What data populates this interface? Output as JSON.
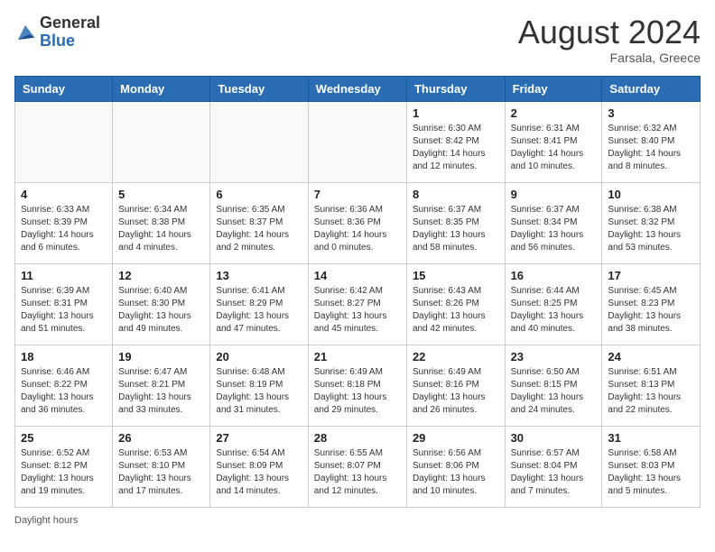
{
  "header": {
    "logo": {
      "general": "General",
      "blue": "Blue"
    },
    "title": "August 2024",
    "location": "Farsala, Greece"
  },
  "days_of_week": [
    "Sunday",
    "Monday",
    "Tuesday",
    "Wednesday",
    "Thursday",
    "Friday",
    "Saturday"
  ],
  "footer": {
    "daylight_hours": "Daylight hours"
  },
  "weeks": [
    [
      {
        "day": "",
        "sunrise": "",
        "sunset": "",
        "daylight": ""
      },
      {
        "day": "",
        "sunrise": "",
        "sunset": "",
        "daylight": ""
      },
      {
        "day": "",
        "sunrise": "",
        "sunset": "",
        "daylight": ""
      },
      {
        "day": "",
        "sunrise": "",
        "sunset": "",
        "daylight": ""
      },
      {
        "day": "1",
        "sunrise": "Sunrise: 6:30 AM",
        "sunset": "Sunset: 8:42 PM",
        "daylight": "Daylight: 14 hours and 12 minutes."
      },
      {
        "day": "2",
        "sunrise": "Sunrise: 6:31 AM",
        "sunset": "Sunset: 8:41 PM",
        "daylight": "Daylight: 14 hours and 10 minutes."
      },
      {
        "day": "3",
        "sunrise": "Sunrise: 6:32 AM",
        "sunset": "Sunset: 8:40 PM",
        "daylight": "Daylight: 14 hours and 8 minutes."
      }
    ],
    [
      {
        "day": "4",
        "sunrise": "Sunrise: 6:33 AM",
        "sunset": "Sunset: 8:39 PM",
        "daylight": "Daylight: 14 hours and 6 minutes."
      },
      {
        "day": "5",
        "sunrise": "Sunrise: 6:34 AM",
        "sunset": "Sunset: 8:38 PM",
        "daylight": "Daylight: 14 hours and 4 minutes."
      },
      {
        "day": "6",
        "sunrise": "Sunrise: 6:35 AM",
        "sunset": "Sunset: 8:37 PM",
        "daylight": "Daylight: 14 hours and 2 minutes."
      },
      {
        "day": "7",
        "sunrise": "Sunrise: 6:36 AM",
        "sunset": "Sunset: 8:36 PM",
        "daylight": "Daylight: 14 hours and 0 minutes."
      },
      {
        "day": "8",
        "sunrise": "Sunrise: 6:37 AM",
        "sunset": "Sunset: 8:35 PM",
        "daylight": "Daylight: 13 hours and 58 minutes."
      },
      {
        "day": "9",
        "sunrise": "Sunrise: 6:37 AM",
        "sunset": "Sunset: 8:34 PM",
        "daylight": "Daylight: 13 hours and 56 minutes."
      },
      {
        "day": "10",
        "sunrise": "Sunrise: 6:38 AM",
        "sunset": "Sunset: 8:32 PM",
        "daylight": "Daylight: 13 hours and 53 minutes."
      }
    ],
    [
      {
        "day": "11",
        "sunrise": "Sunrise: 6:39 AM",
        "sunset": "Sunset: 8:31 PM",
        "daylight": "Daylight: 13 hours and 51 minutes."
      },
      {
        "day": "12",
        "sunrise": "Sunrise: 6:40 AM",
        "sunset": "Sunset: 8:30 PM",
        "daylight": "Daylight: 13 hours and 49 minutes."
      },
      {
        "day": "13",
        "sunrise": "Sunrise: 6:41 AM",
        "sunset": "Sunset: 8:29 PM",
        "daylight": "Daylight: 13 hours and 47 minutes."
      },
      {
        "day": "14",
        "sunrise": "Sunrise: 6:42 AM",
        "sunset": "Sunset: 8:27 PM",
        "daylight": "Daylight: 13 hours and 45 minutes."
      },
      {
        "day": "15",
        "sunrise": "Sunrise: 6:43 AM",
        "sunset": "Sunset: 8:26 PM",
        "daylight": "Daylight: 13 hours and 42 minutes."
      },
      {
        "day": "16",
        "sunrise": "Sunrise: 6:44 AM",
        "sunset": "Sunset: 8:25 PM",
        "daylight": "Daylight: 13 hours and 40 minutes."
      },
      {
        "day": "17",
        "sunrise": "Sunrise: 6:45 AM",
        "sunset": "Sunset: 8:23 PM",
        "daylight": "Daylight: 13 hours and 38 minutes."
      }
    ],
    [
      {
        "day": "18",
        "sunrise": "Sunrise: 6:46 AM",
        "sunset": "Sunset: 8:22 PM",
        "daylight": "Daylight: 13 hours and 36 minutes."
      },
      {
        "day": "19",
        "sunrise": "Sunrise: 6:47 AM",
        "sunset": "Sunset: 8:21 PM",
        "daylight": "Daylight: 13 hours and 33 minutes."
      },
      {
        "day": "20",
        "sunrise": "Sunrise: 6:48 AM",
        "sunset": "Sunset: 8:19 PM",
        "daylight": "Daylight: 13 hours and 31 minutes."
      },
      {
        "day": "21",
        "sunrise": "Sunrise: 6:49 AM",
        "sunset": "Sunset: 8:18 PM",
        "daylight": "Daylight: 13 hours and 29 minutes."
      },
      {
        "day": "22",
        "sunrise": "Sunrise: 6:49 AM",
        "sunset": "Sunset: 8:16 PM",
        "daylight": "Daylight: 13 hours and 26 minutes."
      },
      {
        "day": "23",
        "sunrise": "Sunrise: 6:50 AM",
        "sunset": "Sunset: 8:15 PM",
        "daylight": "Daylight: 13 hours and 24 minutes."
      },
      {
        "day": "24",
        "sunrise": "Sunrise: 6:51 AM",
        "sunset": "Sunset: 8:13 PM",
        "daylight": "Daylight: 13 hours and 22 minutes."
      }
    ],
    [
      {
        "day": "25",
        "sunrise": "Sunrise: 6:52 AM",
        "sunset": "Sunset: 8:12 PM",
        "daylight": "Daylight: 13 hours and 19 minutes."
      },
      {
        "day": "26",
        "sunrise": "Sunrise: 6:53 AM",
        "sunset": "Sunset: 8:10 PM",
        "daylight": "Daylight: 13 hours and 17 minutes."
      },
      {
        "day": "27",
        "sunrise": "Sunrise: 6:54 AM",
        "sunset": "Sunset: 8:09 PM",
        "daylight": "Daylight: 13 hours and 14 minutes."
      },
      {
        "day": "28",
        "sunrise": "Sunrise: 6:55 AM",
        "sunset": "Sunset: 8:07 PM",
        "daylight": "Daylight: 13 hours and 12 minutes."
      },
      {
        "day": "29",
        "sunrise": "Sunrise: 6:56 AM",
        "sunset": "Sunset: 8:06 PM",
        "daylight": "Daylight: 13 hours and 10 minutes."
      },
      {
        "day": "30",
        "sunrise": "Sunrise: 6:57 AM",
        "sunset": "Sunset: 8:04 PM",
        "daylight": "Daylight: 13 hours and 7 minutes."
      },
      {
        "day": "31",
        "sunrise": "Sunrise: 6:58 AM",
        "sunset": "Sunset: 8:03 PM",
        "daylight": "Daylight: 13 hours and 5 minutes."
      }
    ]
  ]
}
